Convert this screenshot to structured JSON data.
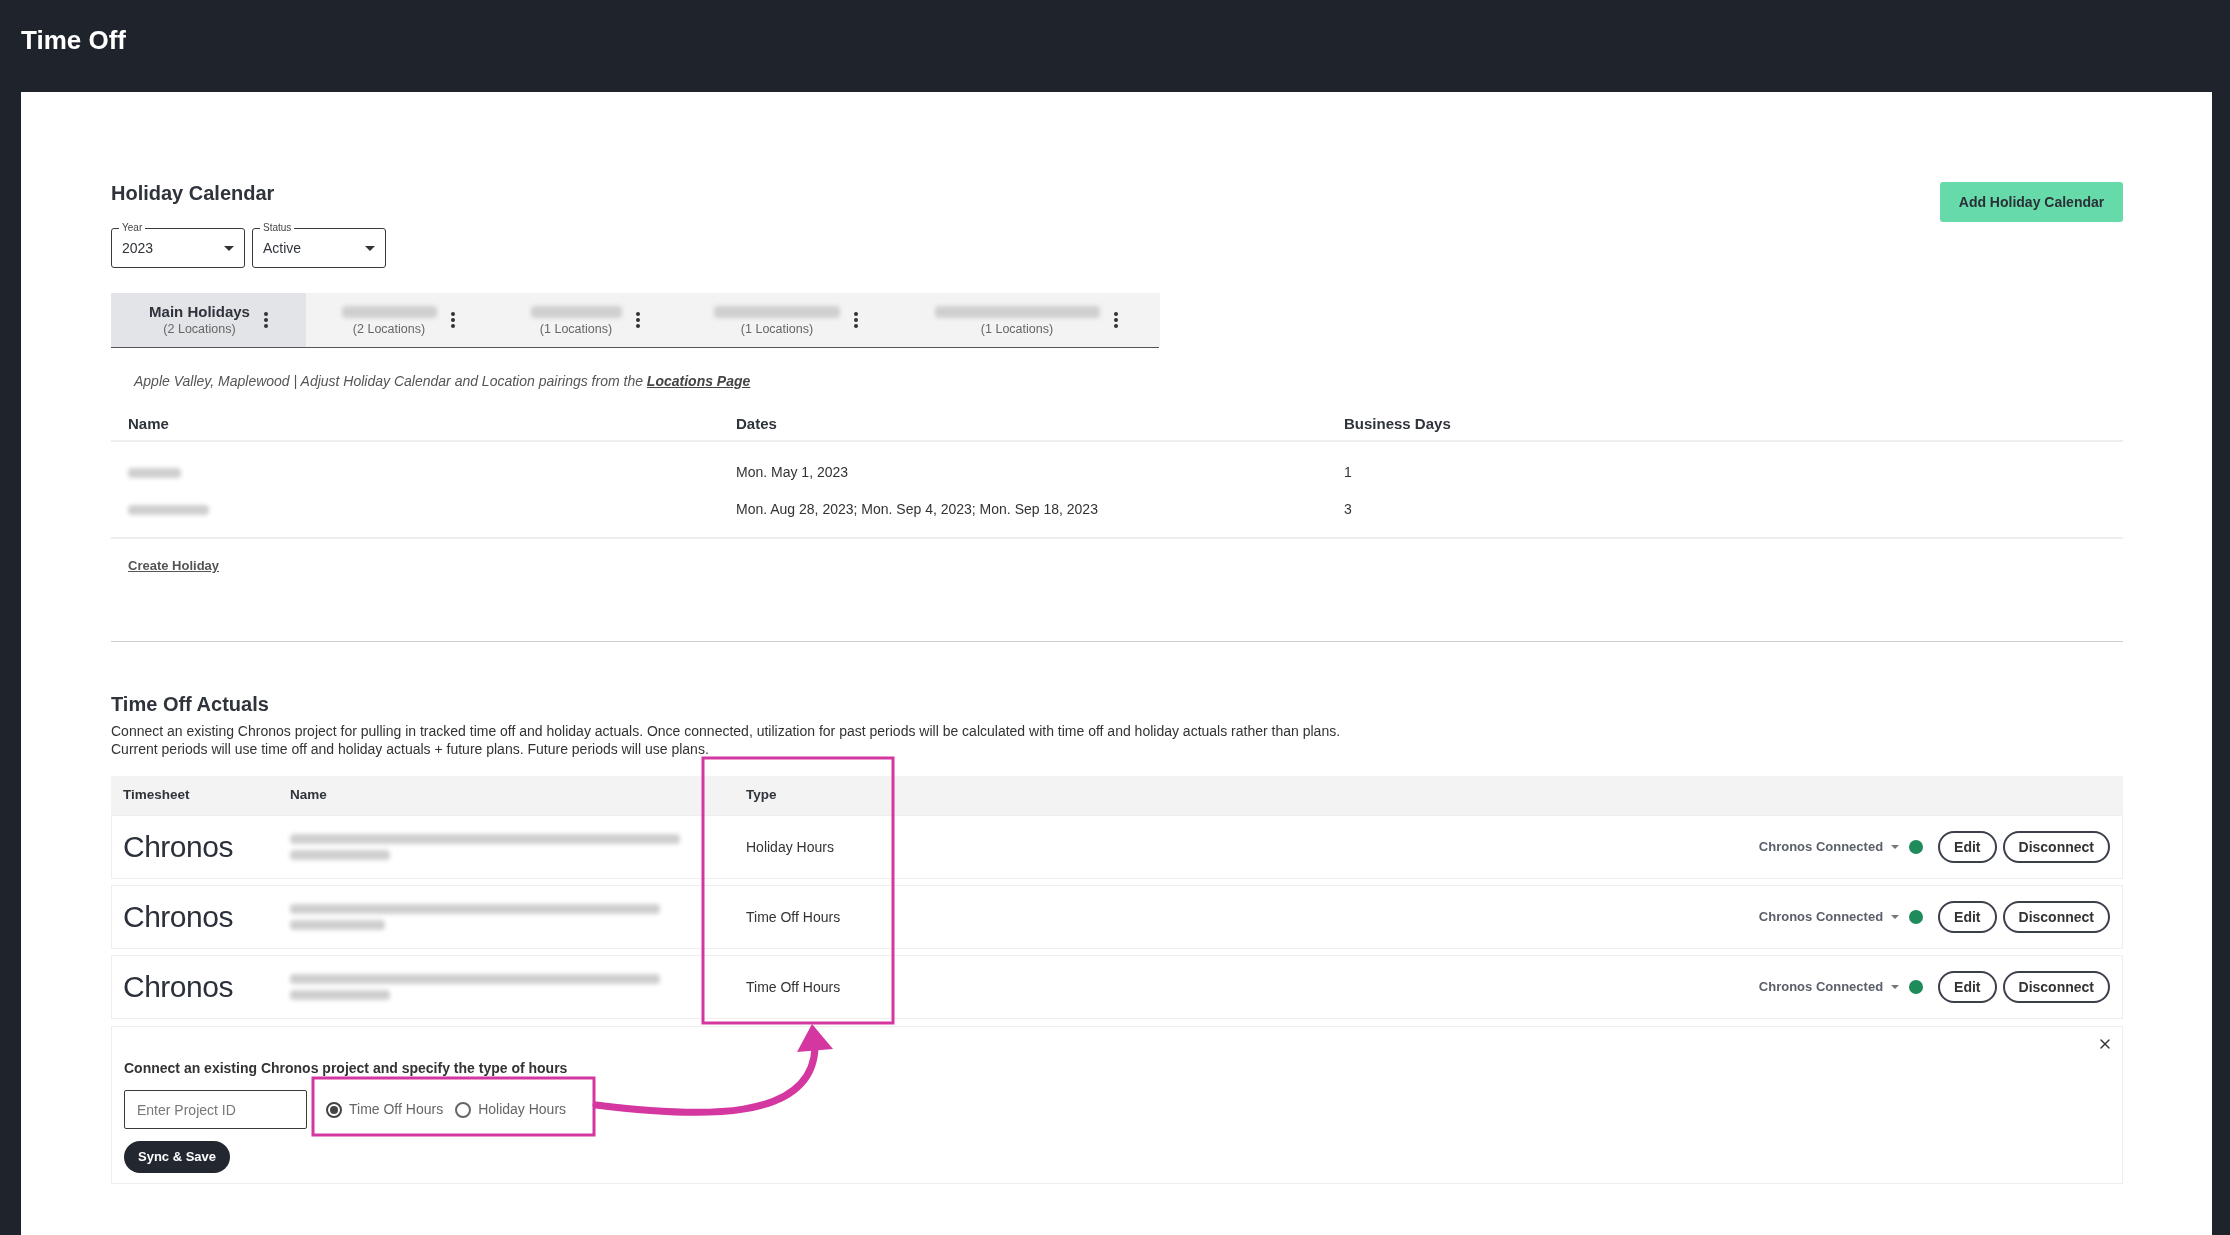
{
  "header": {
    "title": "Time Off"
  },
  "holiday_calendar": {
    "title": "Holiday Calendar",
    "add_button": "Add Holiday Calendar",
    "filters": [
      {
        "label": "Year",
        "value": "2023"
      },
      {
        "label": "Status",
        "value": "Active"
      }
    ],
    "tabs": [
      {
        "label": "Main Holidays",
        "blurred": false,
        "subtitle": "(2 Locations)",
        "selected": true
      },
      {
        "blurred": true,
        "subtitle": "(2 Locations)",
        "selected": false
      },
      {
        "blurred": true,
        "subtitle": "(1 Locations)",
        "selected": false
      },
      {
        "blurred": true,
        "subtitle": "(1 Locations)",
        "selected": false
      },
      {
        "blurred": true,
        "subtitle": "(1 Locations)",
        "selected": false
      }
    ],
    "note": {
      "text": "Apple Valley, Maplewood | Adjust Holiday Calendar and Location pairings from the",
      "link": "Locations Page"
    },
    "table": {
      "columns": [
        "Name",
        "Dates",
        "Business Days"
      ],
      "rows": [
        {
          "dates": "Mon. May 1, 2023",
          "business_days": "1"
        },
        {
          "dates": "Mon. Aug 28, 2023; Mon. Sep 4, 2023; Mon. Sep 18, 2023",
          "business_days": "3"
        }
      ]
    },
    "create_link": "Create Holiday"
  },
  "time_off_actuals": {
    "title": "Time Off Actuals",
    "description": [
      "Connect an existing Chronos project for pulling in tracked time off and holiday actuals. Once connected, utilization for past periods will be calculated with time off and holiday actuals rather than plans.",
      "Current periods will use time off and holiday actuals + future plans. Future periods will use plans."
    ],
    "table": {
      "columns": [
        "Timesheet",
        "Name",
        "Type"
      ],
      "rows": [
        {
          "timesheet": "Chronos",
          "type": "Holiday Hours",
          "status": "Chronos Connected",
          "connected": true,
          "actions": [
            "Edit",
            "Disconnect"
          ]
        },
        {
          "timesheet": "Chronos",
          "type": "Time Off Hours",
          "status": "Chronos Connected",
          "connected": true,
          "actions": [
            "Edit",
            "Disconnect"
          ]
        },
        {
          "timesheet": "Chronos",
          "type": "Time Off Hours",
          "status": "Chronos Connected",
          "connected": true,
          "actions": [
            "Edit",
            "Disconnect"
          ]
        }
      ]
    },
    "connect_form": {
      "label": "Connect an existing Chronos project and specify the type of hours",
      "input": {
        "placeholder": "Enter Project ID"
      },
      "options": [
        {
          "label": "Time Off Hours",
          "selected": true
        },
        {
          "label": "Holiday Hours",
          "selected": false
        }
      ],
      "submit": "Sync & Save"
    }
  }
}
